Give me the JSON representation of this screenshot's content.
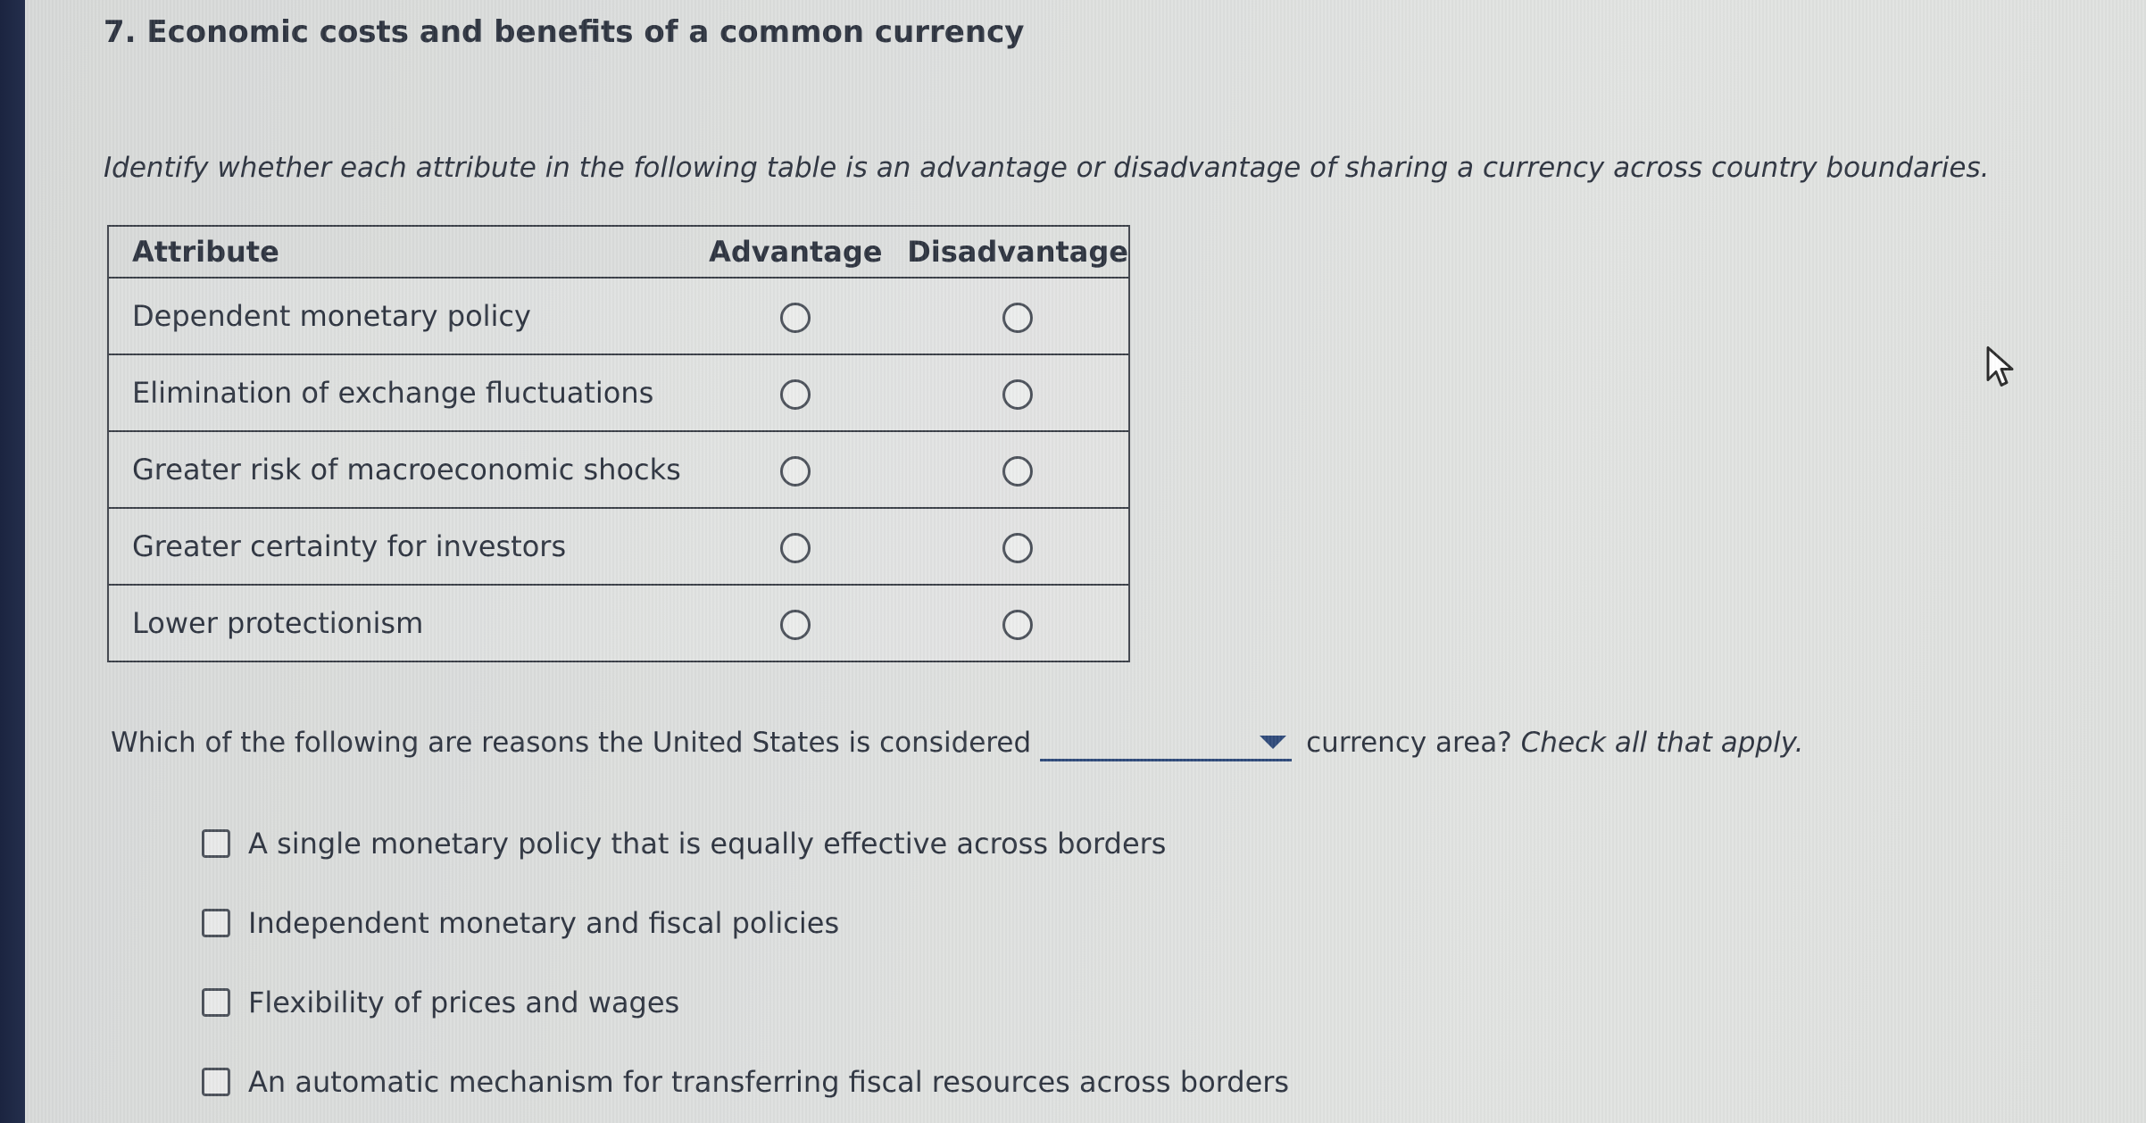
{
  "question": {
    "title": "7. Economic costs and benefits of a common currency",
    "instructions": "Identify whether each attribute in the following table is an advantage or disadvantage of sharing a currency across country boundaries."
  },
  "table": {
    "headers": {
      "attribute": "Attribute",
      "advantage": "Advantage",
      "disadvantage": "Disadvantage"
    },
    "rows": [
      {
        "attribute": "Dependent monetary policy"
      },
      {
        "attribute": "Elimination of exchange fluctuations"
      },
      {
        "attribute": "Greater risk of macroeconomic shocks"
      },
      {
        "attribute": "Greater certainty for investors"
      },
      {
        "attribute": "Lower protectionism"
      }
    ]
  },
  "followup": {
    "prefix": "Which of the following are reasons the United States is considered",
    "dropdown_value": "",
    "suffix": "currency area?",
    "suffix_italic": "Check all that apply.",
    "options": [
      "A single monetary policy that is equally effective across borders",
      "Independent monetary and fiscal policies",
      "Flexibility of prices and wages",
      "An automatic mechanism for transferring fiscal resources across borders"
    ]
  }
}
